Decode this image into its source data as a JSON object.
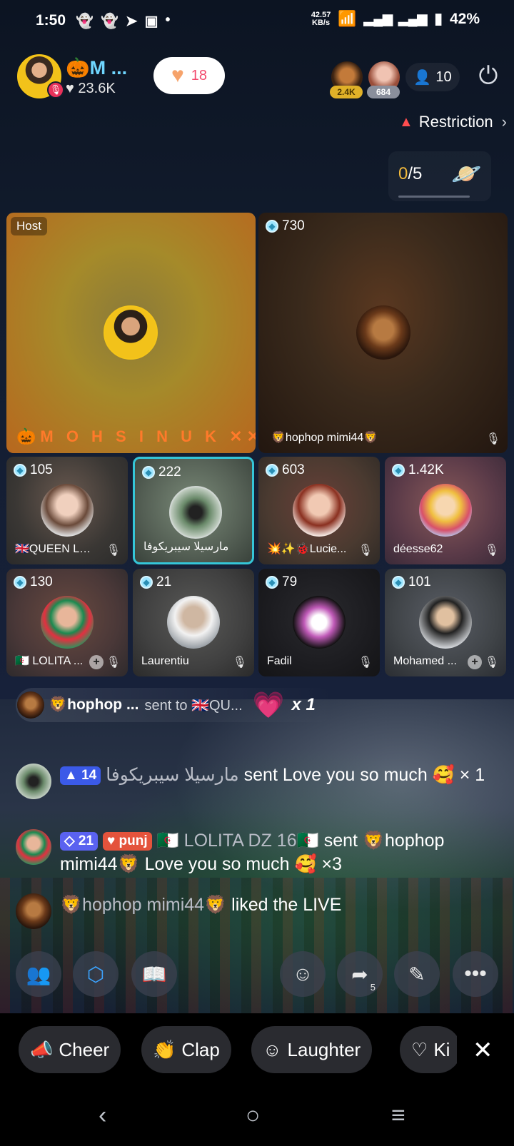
{
  "status_bar": {
    "time": "1:50",
    "speed": "42.57",
    "speed_unit": "KB/s",
    "battery": "42%"
  },
  "host": {
    "name": "🎃M ...",
    "likes": "♥ 23.6K"
  },
  "like_pill": {
    "count": "18"
  },
  "top_viewers": [
    {
      "badge": "2.4K"
    },
    {
      "badge": "684"
    }
  ],
  "viewer_count": "10",
  "restriction_label": "Restriction",
  "seat_counter": {
    "filled": "0",
    "total": "/5"
  },
  "host_tag": "Host",
  "tiles": [
    {
      "score": "",
      "name": "🎃M O H S  I N U K ✕✕⊘"
    },
    {
      "score": "730",
      "name": "🦁hophop mimi44🦁"
    },
    {
      "score": "105",
      "name": "🇬🇧QUEEN LON..."
    },
    {
      "score": "222",
      "name": "مارسيلا سيبريكوفا"
    },
    {
      "score": "603",
      "name": "💥✨🐞Lucie..."
    },
    {
      "score": "1.42K",
      "name": "déesse62"
    },
    {
      "score": "130",
      "name": "🇩🇿 LOLITA ..."
    },
    {
      "score": "21",
      "name": "Laurentiu"
    },
    {
      "score": "79",
      "name": "Fadil"
    },
    {
      "score": "101",
      "name": "Mohamed ..."
    }
  ],
  "gift_banner": {
    "sender": "🦁hophop ...",
    "text": "sent to 🇬🇧QU...",
    "count": "x 1"
  },
  "chat": [
    {
      "badges": [
        "14"
      ],
      "user": "مارسيلا سيبريكوفا",
      "text": " sent Love you so much 🥰 × 1"
    },
    {
      "badges": [
        "21",
        "punj"
      ],
      "user": "🇩🇿 LOLITA DZ 16🇩🇿",
      "text": " sent 🦁hophop mimi44🦁 Love you so much 🥰 ×3"
    },
    {
      "badges": [],
      "user": "🦁hophop mimi44🦁",
      "text": " liked the LIVE"
    }
  ],
  "share_count": "5",
  "reactions": [
    "Cheer",
    "Clap",
    "Laughter",
    "Ki"
  ],
  "icons": {
    "heart": "heart-icon",
    "person": "person-icon",
    "power": "power-icon",
    "warning": "warning-icon",
    "planet": "planet-icon",
    "mic_off": "mic-off-icon"
  },
  "colors": {
    "accent_cyan": "#35c6d8",
    "like_red": "#f2476b",
    "warning_red": "#ff4d4f",
    "host_name_blue": "#6fd6ff"
  }
}
